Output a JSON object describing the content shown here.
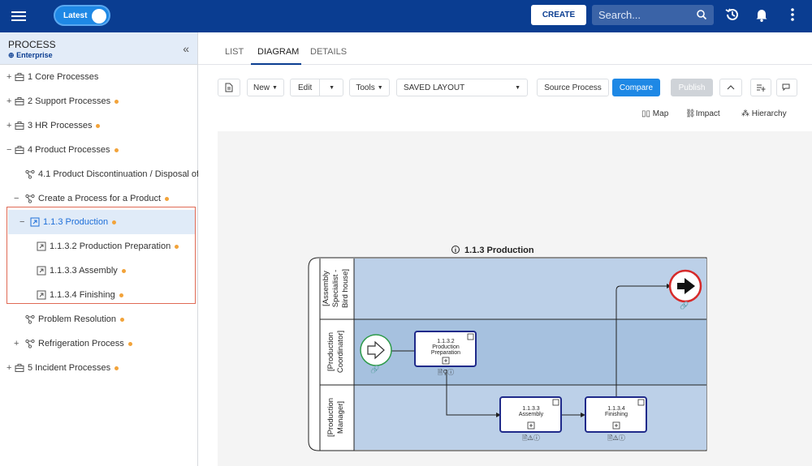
{
  "topbar": {
    "toggle_label": "Latest",
    "create_label": "CREATE",
    "search_placeholder": "Search..."
  },
  "left": {
    "title": "PROCESS",
    "subtitle": "Enterprise",
    "items": [
      {
        "label": "1 Core Processes"
      },
      {
        "label": "2 Support Processes"
      },
      {
        "label": "3 HR Processes"
      },
      {
        "label": "4 Product Processes"
      },
      {
        "label": "4.1 Product Discontinuation / Disposal of"
      },
      {
        "label": "Create a Process for a Product"
      },
      {
        "label": "1.1.3 Production"
      },
      {
        "label": "1.1.3.2 Production Preparation"
      },
      {
        "label": "1.1.3.3 Assembly"
      },
      {
        "label": "1.1.3.4 Finishing"
      },
      {
        "label": "Problem Resolution"
      },
      {
        "label": "Refrigeration Process"
      },
      {
        "label": "5 Incident Processes"
      }
    ]
  },
  "tabs": {
    "list": "LIST",
    "diagram": "DIAGRAM",
    "details": "DETAILS"
  },
  "toolbar": {
    "new": "New",
    "edit": "Edit",
    "tools": "Tools",
    "layout": "SAVED LAYOUT",
    "source": "Source Process",
    "compare": "Compare",
    "publish": "Publish"
  },
  "views": {
    "map": "Map",
    "impact": "Impact",
    "hierarchy": "Hierarchy"
  },
  "diagram": {
    "title": "1.1.3 Production",
    "lanes": [
      {
        "line1": "[Assembly",
        "line2": "Specialist -",
        "line3": "Bird house]"
      },
      {
        "line1": "[Production",
        "line2": "Coordinator]",
        "line3": ""
      },
      {
        "line1": "[Production",
        "line2": "Manager]",
        "line3": ""
      }
    ],
    "tasks": [
      {
        "id": "1.1.3.2",
        "line1": "Production",
        "line2": "Preparation"
      },
      {
        "id": "1.1.3.3",
        "line1": "Assembly",
        "line2": ""
      },
      {
        "id": "1.1.3.4",
        "line1": "Finishing",
        "line2": ""
      }
    ]
  }
}
